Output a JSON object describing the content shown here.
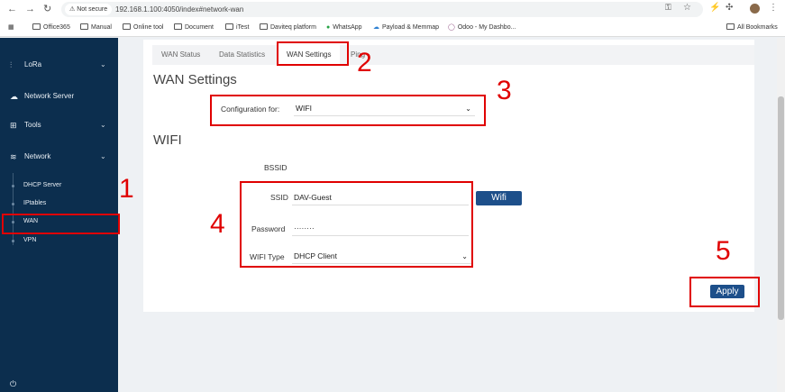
{
  "browser": {
    "url": "192.168.1.100:4050/index#network-wan",
    "not_secure_label": "Not secure",
    "bookmarks": [
      "Office365",
      "Manual",
      "Online tool",
      "Document",
      "iTest",
      "Daviteq platform",
      "WhatsApp",
      "Payload & Memmap",
      "Odoo - My Dashbo..."
    ],
    "all_bookmarks_label": "All Bookmarks"
  },
  "sidebar": {
    "items": [
      {
        "label": "LoRa",
        "icon": "lora-icon"
      },
      {
        "label": "Network Server",
        "icon": "cloud-icon"
      },
      {
        "label": "Tools",
        "icon": "tools-icon"
      },
      {
        "label": "Network",
        "icon": "wifi-icon"
      }
    ],
    "network_subitems": [
      "DHCP Server",
      "IPtables",
      "WAN",
      "VPN"
    ],
    "power_icon": "power-icon"
  },
  "tabs": [
    "WAN Status",
    "Data Statistics",
    "WAN Settings",
    "Ping"
  ],
  "active_tab": "WAN Settings",
  "wan_settings": {
    "heading": "WAN Settings",
    "config_label": "Configuration for:",
    "config_value": "WIFI"
  },
  "wifi": {
    "heading": "WIFI",
    "bssid_label": "BSSID",
    "ssid_label": "SSID",
    "ssid_value": "DAV-Guest",
    "wifi_button": "Wifi",
    "password_label": "Password",
    "password_value": "········",
    "type_label": "WIFI Type",
    "type_value": "DHCP Client"
  },
  "apply_button": "Apply",
  "annotations": [
    "1",
    "2",
    "3",
    "4",
    "5"
  ],
  "colors": {
    "sidebar": "#0c2e4e",
    "button": "#1d4f8a",
    "annotation": "#e00000"
  }
}
